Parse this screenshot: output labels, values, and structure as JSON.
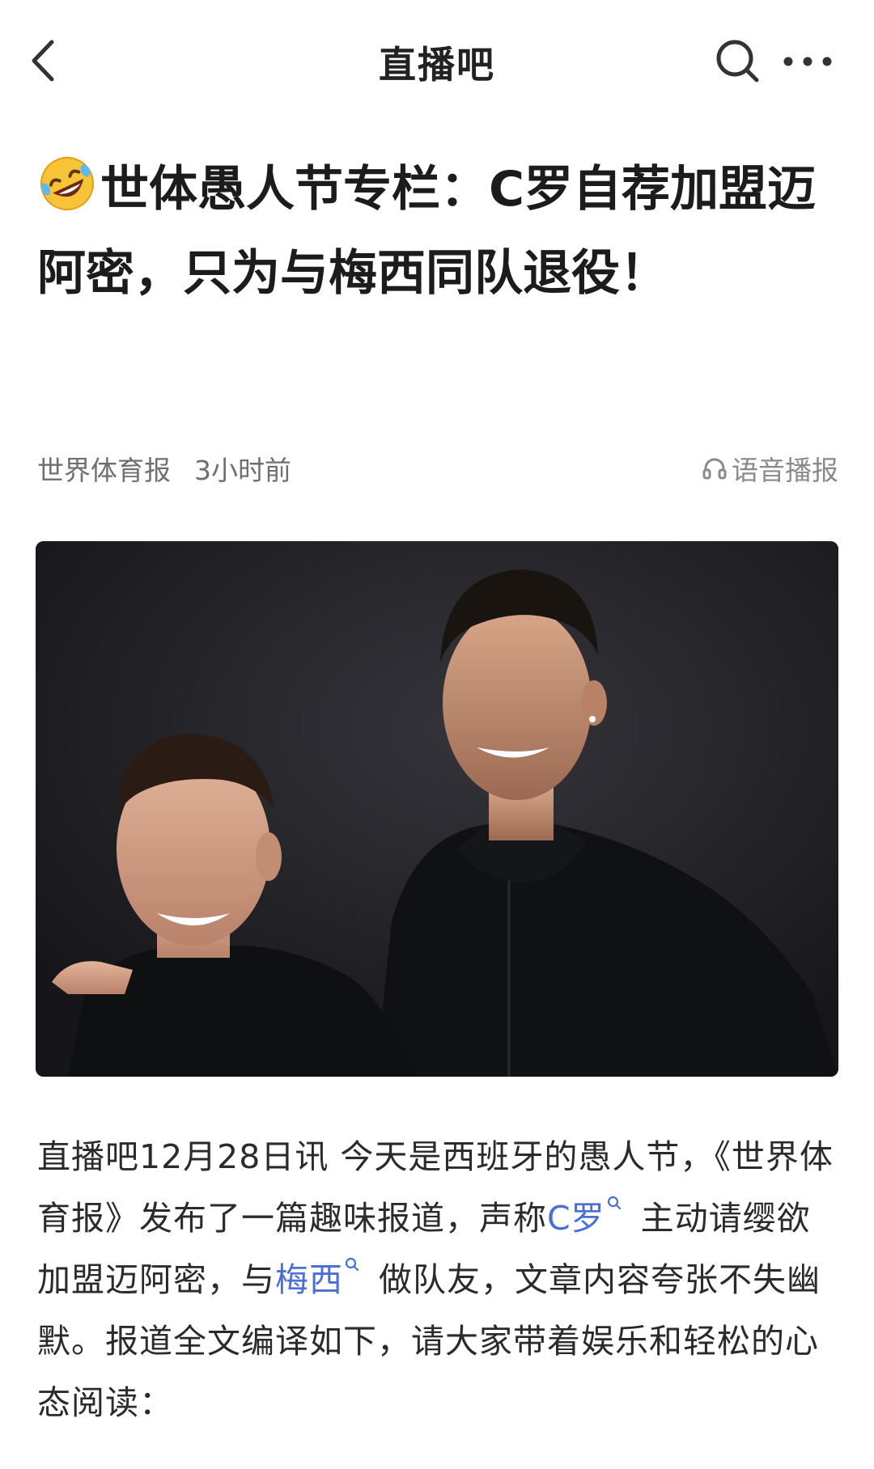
{
  "navbar": {
    "title": "直播吧",
    "back_icon": "chevron-left-icon",
    "search_icon": "search-icon",
    "more_icon": "more-dots-icon"
  },
  "article": {
    "title_emoji": "rolling-on-floor-laughing-emoji",
    "title": "世体愚人节专栏：C罗自荐加盟迈阿密，只为与梅西同队退役！",
    "source": "世界体育报",
    "time": "3小时前",
    "audio_label": "语音播报",
    "audio_icon": "headphones-icon",
    "image_alt": "梅西与C罗合影",
    "body": {
      "part1": "直播吧12月28日讯 今天是西班牙的愚人节，《世界体育报》发布了一篇趣味报道，声称",
      "link1": "C罗",
      "part2": " 主动请缨欲加盟迈阿密，与",
      "link2": "梅西",
      "part3": " 做队友，文章内容夸张不失幽默。报道全文编译如下，请大家带着娱乐和轻松的心态阅读："
    }
  },
  "colors": {
    "link": "#4a6fd6",
    "meta": "#6f6f6f",
    "title": "#1c1c1c"
  }
}
